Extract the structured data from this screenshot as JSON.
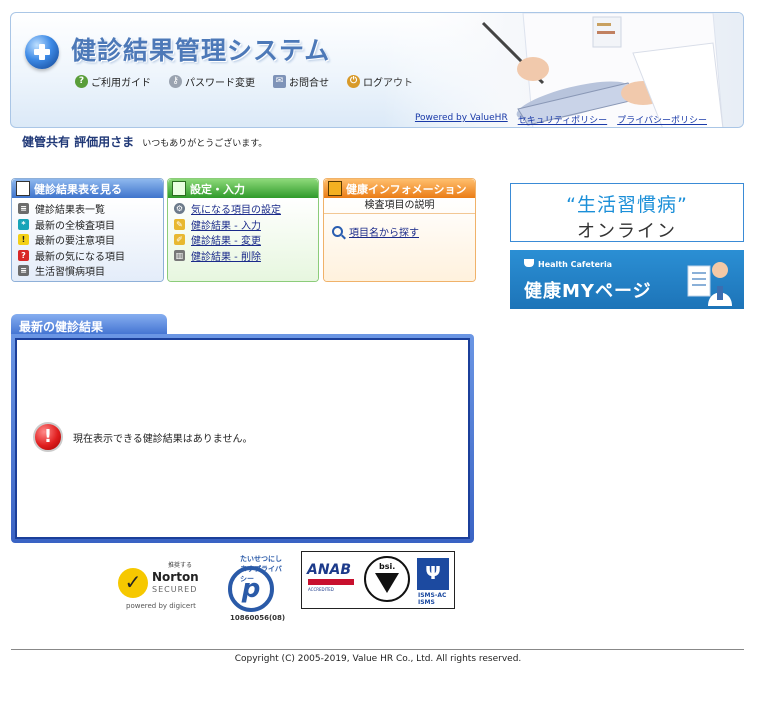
{
  "header": {
    "system_title": "健診結果管理システム",
    "nav": [
      {
        "label": "ご利用ガイド",
        "icon": "help-icon"
      },
      {
        "label": "パスワード変更",
        "icon": "key-icon"
      },
      {
        "label": "お問合せ",
        "icon": "mail-icon"
      },
      {
        "label": "ログアウト",
        "icon": "logout-icon"
      }
    ],
    "links": {
      "powered": "Powered by ValueHR",
      "security": "セキュリティポリシー",
      "privacy": "プライバシーポリシー"
    }
  },
  "greeting": {
    "user": "健管共有 評価用さま",
    "message": "いつもありがとうございます。"
  },
  "menus": {
    "results": {
      "title": "健診結果表を見る",
      "items": [
        {
          "label": "健診結果表一覧",
          "icon": "list-icon"
        },
        {
          "label": "最新の全検査項目",
          "icon": "asterisk-icon"
        },
        {
          "label": "最新の要注意項目",
          "icon": "warning-icon"
        },
        {
          "label": "最新の気になる項目",
          "icon": "question-icon"
        },
        {
          "label": "生活習慣病項目",
          "icon": "list-icon"
        }
      ]
    },
    "settings": {
      "title": "設定・入力",
      "items": [
        {
          "label": "気になる項目の設定",
          "icon": "gear-icon"
        },
        {
          "label": "健診結果 - 入力",
          "icon": "pencil-icon"
        },
        {
          "label": "健診結果 - 変更",
          "icon": "edit-icon"
        },
        {
          "label": "健診結果 - 削除",
          "icon": "trash-icon"
        }
      ]
    },
    "info": {
      "title": "健康インフォメーション",
      "subtitle": "検査項目の説明",
      "search_label": "項目名から探す"
    }
  },
  "banners": {
    "lifestyle": {
      "line1": "“生活習慣病”",
      "line2": "オンライン"
    },
    "cafeteria": {
      "small": "Health Cafeteria",
      "big": "健康MYページ"
    }
  },
  "latest": {
    "title": "最新の健診結果",
    "message": "現在表示できる健診結果はありません。"
  },
  "seals": {
    "norton": {
      "recommend": "推奨する",
      "name": "Norton",
      "secured": "SECURED",
      "powered": "powered by digicert"
    },
    "privacy": {
      "arc": "たいせつにしますプライバシー",
      "number": "10860056(08)"
    },
    "isms": {
      "anab": "ANAB",
      "anab_sub": "ACCREDITED",
      "bsi": "bsi.",
      "jip_sub": "ISMS-AC ISMS"
    }
  },
  "footer": {
    "copyright": "Copyright (C) 2005-2019, Value HR Co., Ltd. All rights reserved."
  },
  "colors": {
    "accent_blue": "#3f70d0",
    "accent_green": "#2f9a2a",
    "accent_orange": "#ea7c16",
    "link": "#1a2a8a"
  }
}
